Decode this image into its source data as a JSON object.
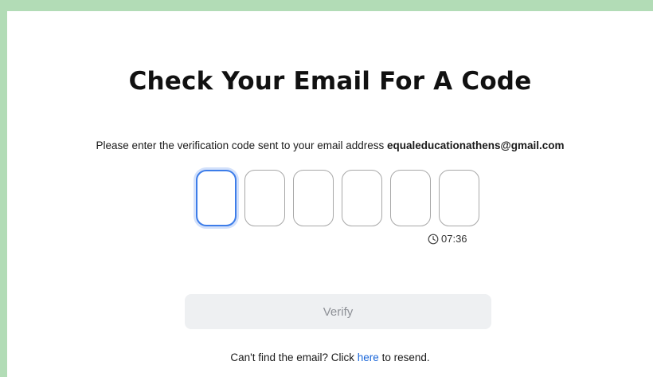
{
  "page": {
    "title": "Check Your Email For A Code",
    "instructions": "Please enter the verification code sent to your email address",
    "email": "equaleducationathens@gmail.com"
  },
  "code_inputs": {
    "count": 6,
    "values": [
      "",
      "",
      "",
      "",
      "",
      ""
    ],
    "active_index": 0
  },
  "timer": {
    "icon": "clock-icon",
    "value": "07:36"
  },
  "verify_button": {
    "label": "Verify",
    "enabled": false
  },
  "resend": {
    "prefix": "Can't find the email? Click",
    "link_text": "here",
    "suffix": "to resend."
  },
  "colors": {
    "background": "#b2dcb6",
    "card": "#ffffff",
    "active_border": "#3d7de9",
    "link": "#1a66d8",
    "button_bg": "#eef0f2",
    "button_text": "#8d9096"
  }
}
